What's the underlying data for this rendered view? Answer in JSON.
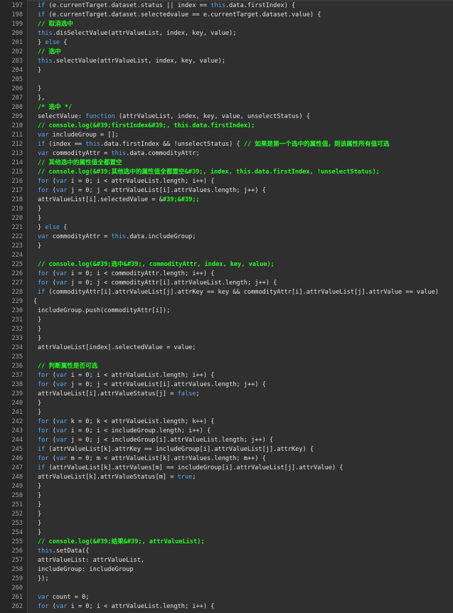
{
  "editor": {
    "colors": {
      "background": "#2f2f2f",
      "gutter": "#262626",
      "keyword": "#5aa8f2",
      "comment": "#22ff22",
      "text": "#e6e6e6",
      "lineNumber": "#a0a0a0"
    },
    "lines": [
      {
        "n": "197",
        "indent": 0,
        "tokens": [
          [
            "kw",
            "if"
          ],
          [
            "t",
            " (e.currentTarget.dataset.status || index == "
          ],
          [
            "kw",
            "this"
          ],
          [
            "t",
            ".data.firstIndex) {"
          ]
        ]
      },
      {
        "n": "198",
        "indent": 0,
        "tokens": [
          [
            "kw",
            "if"
          ],
          [
            "t",
            " (e.currentTarget.dataset.selectedvalue == e.currentTarget.dataset.value) {"
          ]
        ]
      },
      {
        "n": "199",
        "indent": 0,
        "tokens": [
          [
            "cm",
            "// 取消选中"
          ]
        ]
      },
      {
        "n": "200",
        "indent": 0,
        "tokens": [
          [
            "kw",
            "this"
          ],
          [
            "t",
            ".disSelectValue(attrValueList, index, key, value);"
          ]
        ]
      },
      {
        "n": "201",
        "indent": 0,
        "tokens": [
          [
            "t",
            "} "
          ],
          [
            "kw",
            "else"
          ],
          [
            "t",
            " {"
          ]
        ]
      },
      {
        "n": "202",
        "indent": 0,
        "tokens": [
          [
            "cm",
            "// 选中"
          ]
        ]
      },
      {
        "n": "203",
        "indent": 0,
        "tokens": [
          [
            "kw",
            "this"
          ],
          [
            "t",
            ".selectValue(attrValueList, index, key, value);"
          ]
        ]
      },
      {
        "n": "204",
        "indent": 0,
        "tokens": [
          [
            "t",
            "}"
          ]
        ]
      },
      {
        "n": "205",
        "indent": 0,
        "tokens": []
      },
      {
        "n": "206",
        "indent": 0,
        "tokens": [
          [
            "t",
            "}"
          ]
        ]
      },
      {
        "n": "207",
        "indent": 0,
        "tokens": [
          [
            "t",
            "},"
          ]
        ]
      },
      {
        "n": "208",
        "indent": 0,
        "tokens": [
          [
            "cm",
            "/* 选中 */"
          ]
        ]
      },
      {
        "n": "209",
        "indent": 0,
        "tokens": [
          [
            "t",
            "selectValue: "
          ],
          [
            "kw",
            "function"
          ],
          [
            "t",
            " (attrValueList, index, key, value, unselectStatus) {"
          ]
        ]
      },
      {
        "n": "210",
        "indent": 0,
        "tokens": [
          [
            "cm",
            "// console.log(&#39;firstIndex&#39;, this.data.firstIndex);"
          ]
        ]
      },
      {
        "n": "211",
        "indent": 0,
        "tokens": [
          [
            "kw",
            "var"
          ],
          [
            "t",
            " includeGroup = [];"
          ]
        ]
      },
      {
        "n": "212",
        "indent": 0,
        "tokens": [
          [
            "kw",
            "if"
          ],
          [
            "t",
            " (index == "
          ],
          [
            "kw",
            "this"
          ],
          [
            "t",
            ".data.firstIndex && !unselectStatus) { "
          ],
          [
            "cm",
            "// 如果是第一个选中的属性值，则该属性所有值可选"
          ]
        ]
      },
      {
        "n": "213",
        "indent": 0,
        "tokens": [
          [
            "kw",
            "var"
          ],
          [
            "t",
            " commodityAttr = "
          ],
          [
            "kw",
            "this"
          ],
          [
            "t",
            ".data.commodityAttr;"
          ]
        ]
      },
      {
        "n": "214",
        "indent": 0,
        "tokens": [
          [
            "cm",
            "// 其他选中的属性值全都置空"
          ]
        ]
      },
      {
        "n": "215",
        "indent": 0,
        "tokens": [
          [
            "cm",
            "// console.log(&#39;其他选中的属性值全都置空&#39;, index, this.data.firstIndex, !unselectStatus);"
          ]
        ]
      },
      {
        "n": "216",
        "indent": 0,
        "tokens": [
          [
            "kw",
            "for"
          ],
          [
            "t",
            " ("
          ],
          [
            "kw",
            "var"
          ],
          [
            "t",
            " i = 0; i < attrValueList.length; i++) {"
          ]
        ]
      },
      {
        "n": "217",
        "indent": 0,
        "tokens": [
          [
            "kw",
            "for"
          ],
          [
            "t",
            " ("
          ],
          [
            "kw",
            "var"
          ],
          [
            "t",
            " j = 0; j < attrValueList[i].attrValues.length; j++) {"
          ]
        ]
      },
      {
        "n": "218",
        "indent": 0,
        "tokens": [
          [
            "t",
            "attrValueList[i].selectedValue = &"
          ],
          [
            "cm",
            "#39;&#39;;"
          ]
        ]
      },
      {
        "n": "219",
        "indent": 0,
        "tokens": [
          [
            "t",
            "}"
          ]
        ]
      },
      {
        "n": "220",
        "indent": 0,
        "tokens": [
          [
            "t",
            "}"
          ]
        ]
      },
      {
        "n": "221",
        "indent": 0,
        "tokens": [
          [
            "t",
            "} "
          ],
          [
            "kw",
            "else"
          ],
          [
            "t",
            " {"
          ]
        ]
      },
      {
        "n": "222",
        "indent": 0,
        "tokens": [
          [
            "kw",
            "var"
          ],
          [
            "t",
            " commodityAttr = "
          ],
          [
            "kw",
            "this"
          ],
          [
            "t",
            ".data.includeGroup;"
          ]
        ]
      },
      {
        "n": "223",
        "indent": 0,
        "tokens": [
          [
            "t",
            "}"
          ]
        ]
      },
      {
        "n": "224",
        "indent": 0,
        "tokens": []
      },
      {
        "n": "225",
        "indent": 0,
        "tokens": [
          [
            "cm",
            "// console.log(&#39;选中&#39;, commodityAttr, index, key, value);"
          ]
        ]
      },
      {
        "n": "226",
        "indent": 0,
        "tokens": [
          [
            "kw",
            "for"
          ],
          [
            "t",
            " ("
          ],
          [
            "kw",
            "var"
          ],
          [
            "t",
            " i = 0; i < commodityAttr.length; i++) {"
          ]
        ]
      },
      {
        "n": "227",
        "indent": 0,
        "tokens": [
          [
            "kw",
            "for"
          ],
          [
            "t",
            " ("
          ],
          [
            "kw",
            "var"
          ],
          [
            "t",
            " j = 0; j < commodityAttr[i].attrValueList.length; j++) {"
          ]
        ]
      },
      {
        "n": "228",
        "indent": 0,
        "tokens": [
          [
            "kw",
            "if"
          ],
          [
            "t",
            " (commodityAttr[i].attrValueList[j].attrKey == key && commodityAttr[i].attrValueList[j].attrValue == value)"
          ]
        ]
      },
      {
        "n": "229",
        "indent": -1,
        "tokens": [
          [
            "t",
            "{"
          ]
        ]
      },
      {
        "n": "230",
        "indent": 0,
        "tokens": [
          [
            "t",
            "includeGroup.push(commodityAttr[i]);"
          ]
        ]
      },
      {
        "n": "231",
        "indent": 0,
        "tokens": [
          [
            "t",
            "}"
          ]
        ]
      },
      {
        "n": "232",
        "indent": 0,
        "tokens": [
          [
            "t",
            "}"
          ]
        ]
      },
      {
        "n": "233",
        "indent": 0,
        "tokens": [
          [
            "t",
            "}"
          ]
        ]
      },
      {
        "n": "234",
        "indent": 0,
        "tokens": [
          [
            "t",
            "attrValueList[index].selectedValue = value;"
          ]
        ]
      },
      {
        "n": "235",
        "indent": 0,
        "tokens": []
      },
      {
        "n": "236",
        "indent": 0,
        "tokens": [
          [
            "cm",
            "// 判断属性是否可选"
          ]
        ]
      },
      {
        "n": "237",
        "indent": 0,
        "tokens": [
          [
            "kw",
            "for"
          ],
          [
            "t",
            " ("
          ],
          [
            "kw",
            "var"
          ],
          [
            "t",
            " i = 0; i < attrValueList.length; i++) {"
          ]
        ]
      },
      {
        "n": "238",
        "indent": 0,
        "tokens": [
          [
            "kw",
            "for"
          ],
          [
            "t",
            " ("
          ],
          [
            "kw",
            "var"
          ],
          [
            "t",
            " j = 0; j < attrValueList[i].attrValues.length; j++) {"
          ]
        ]
      },
      {
        "n": "239",
        "indent": 0,
        "tokens": [
          [
            "t",
            "attrValueList[i].attrValueStatus[j] = "
          ],
          [
            "kw",
            "false"
          ],
          [
            "t",
            ";"
          ]
        ]
      },
      {
        "n": "240",
        "indent": 0,
        "tokens": [
          [
            "t",
            "}"
          ]
        ]
      },
      {
        "n": "241",
        "indent": 0,
        "tokens": [
          [
            "t",
            "}"
          ]
        ]
      },
      {
        "n": "242",
        "indent": 0,
        "tokens": [
          [
            "kw",
            "for"
          ],
          [
            "t",
            " ("
          ],
          [
            "kw",
            "var"
          ],
          [
            "t",
            " k = 0; k < attrValueList.length; k++) {"
          ]
        ]
      },
      {
        "n": "243",
        "indent": 0,
        "tokens": [
          [
            "kw",
            "for"
          ],
          [
            "t",
            " ("
          ],
          [
            "kw",
            "var"
          ],
          [
            "t",
            " i = 0; i < includeGroup.length; i++) {"
          ]
        ]
      },
      {
        "n": "244",
        "indent": 0,
        "tokens": [
          [
            "kw",
            "for"
          ],
          [
            "t",
            " ("
          ],
          [
            "kw",
            "var"
          ],
          [
            "t",
            " j = 0; j < includeGroup[i].attrValueList.length; j++) {"
          ]
        ]
      },
      {
        "n": "245",
        "indent": 0,
        "tokens": [
          [
            "kw",
            "if"
          ],
          [
            "t",
            " (attrValueList[k].attrKey == includeGroup[i].attrValueList[j].attrKey) {"
          ]
        ]
      },
      {
        "n": "246",
        "indent": 0,
        "tokens": [
          [
            "kw",
            "for"
          ],
          [
            "t",
            " ("
          ],
          [
            "kw",
            "var"
          ],
          [
            "t",
            " m = 0; m < attrValueList[k].attrValues.length; m++) {"
          ]
        ]
      },
      {
        "n": "247",
        "indent": 0,
        "tokens": [
          [
            "kw",
            "if"
          ],
          [
            "t",
            " (attrValueList[k].attrValues[m] == includeGroup[i].attrValueList[j].attrValue) {"
          ]
        ]
      },
      {
        "n": "248",
        "indent": 0,
        "tokens": [
          [
            "t",
            "attrValueList[k].attrValueStatus[m] = "
          ],
          [
            "kw",
            "true"
          ],
          [
            "t",
            ";"
          ]
        ]
      },
      {
        "n": "249",
        "indent": 0,
        "tokens": [
          [
            "t",
            "}"
          ]
        ]
      },
      {
        "n": "250",
        "indent": 0,
        "tokens": [
          [
            "t",
            "}"
          ]
        ]
      },
      {
        "n": "251",
        "indent": 0,
        "tokens": [
          [
            "t",
            "}"
          ]
        ]
      },
      {
        "n": "252",
        "indent": 0,
        "tokens": [
          [
            "t",
            "}"
          ]
        ]
      },
      {
        "n": "253",
        "indent": 0,
        "tokens": [
          [
            "t",
            "}"
          ]
        ]
      },
      {
        "n": "254",
        "indent": 0,
        "tokens": [
          [
            "t",
            "}"
          ]
        ]
      },
      {
        "n": "255",
        "indent": 0,
        "tokens": [
          [
            "cm",
            "// console.log(&#39;结果&#39;, attrValueList);"
          ]
        ]
      },
      {
        "n": "256",
        "indent": 0,
        "tokens": [
          [
            "kw",
            "this"
          ],
          [
            "t",
            ".setData({"
          ]
        ]
      },
      {
        "n": "257",
        "indent": 0,
        "tokens": [
          [
            "t",
            "attrValueList: attrValueList,"
          ]
        ]
      },
      {
        "n": "258",
        "indent": 0,
        "tokens": [
          [
            "t",
            "includeGroup: includeGroup"
          ]
        ]
      },
      {
        "n": "259",
        "indent": 0,
        "tokens": [
          [
            "t",
            "});"
          ]
        ]
      },
      {
        "n": "260",
        "indent": 0,
        "tokens": []
      },
      {
        "n": "261",
        "indent": 0,
        "tokens": [
          [
            "kw",
            "var"
          ],
          [
            "t",
            " count = 0;"
          ]
        ]
      },
      {
        "n": "262",
        "indent": 0,
        "tokens": [
          [
            "kw",
            "for"
          ],
          [
            "t",
            " ("
          ],
          [
            "kw",
            "var"
          ],
          [
            "t",
            " i = 0; i < attrValueList.length; i++) {"
          ]
        ]
      }
    ]
  }
}
